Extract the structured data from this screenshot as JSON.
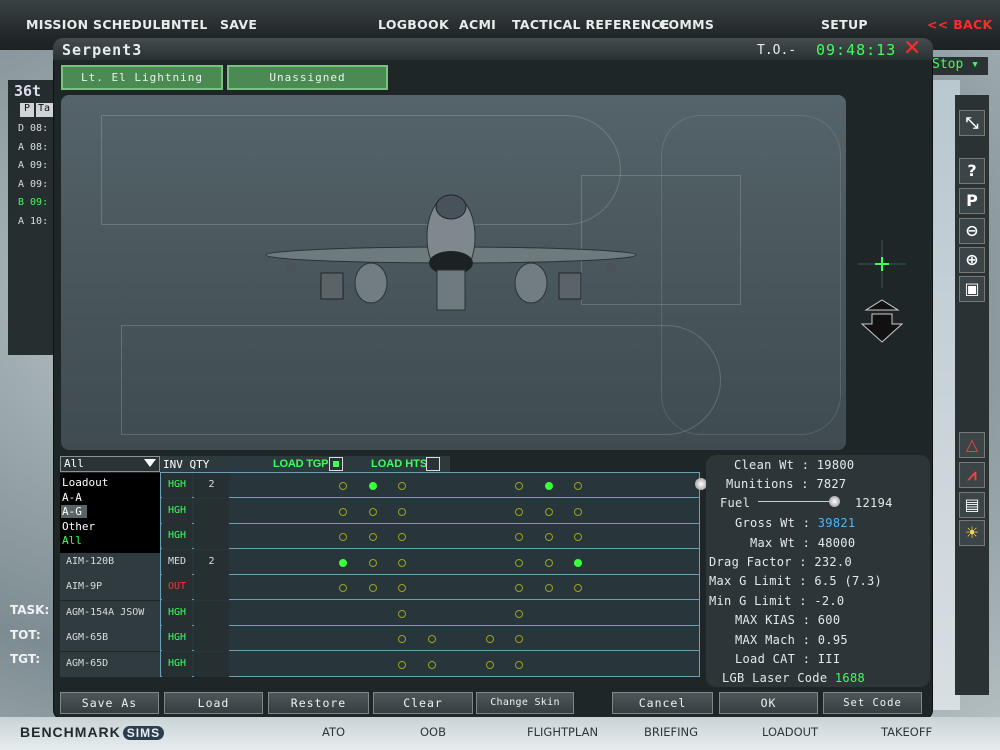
{
  "top_menu": {
    "mission_schedule": "MISSION SCHEDULE",
    "intel": "INTEL",
    "save": "SAVE",
    "logbook": "LOGBOOK",
    "acmi": "ACMI",
    "tactical_reference": "TACTICAL REFERENCE",
    "comms": "COMMS",
    "setup": "SETUP",
    "back": "<< BACK"
  },
  "background_left": {
    "title": "36t",
    "headers": [
      "P",
      "Ta"
    ],
    "rows": [
      {
        "p": "D",
        "t": "08:",
        "color": "#dddddd"
      },
      {
        "p": "A",
        "t": "08:",
        "color": "#dddddd"
      },
      {
        "p": "A",
        "t": "09:",
        "color": "#dddddd"
      },
      {
        "p": "A",
        "t": "09:",
        "color": "#dddddd"
      },
      {
        "p": "B",
        "t": "09:",
        "color": "#3cff5a"
      },
      {
        "p": "A",
        "t": "10:",
        "color": "#dddddd"
      }
    ],
    "task_label": "TASK:",
    "tot_label": "TOT:",
    "tgt_label": "TGT:"
  },
  "background_right": {
    "stop_label": "Stop ▾"
  },
  "window": {
    "title": "Serpent3",
    "to_label": "T.O.-",
    "clock": "09:48:13",
    "pilot_tabs": [
      "Lt. El Lightning",
      "Unassigned"
    ]
  },
  "loadout": {
    "filter_selected": "All",
    "filter_options": [
      {
        "label": "Loadout",
        "state": "normal"
      },
      {
        "label": "A-A",
        "state": "normal"
      },
      {
        "label": "A-G",
        "state": "selected"
      },
      {
        "label": "Other",
        "state": "normal"
      },
      {
        "label": "All",
        "state": "active"
      }
    ],
    "header_inv_qty": "INV QTY",
    "load_tgp_label": "LOAD TGP",
    "load_tgp_checked": true,
    "load_hts_label": "LOAD HTS",
    "load_hts_checked": false,
    "weapons": [
      {
        "name": "",
        "inv": "HGH",
        "qty": "2",
        "inv_color": "#3cff5a",
        "filled": [
          2,
          7
        ],
        "empty": [
          1,
          3,
          6,
          8
        ]
      },
      {
        "name": "",
        "inv": "HGH",
        "qty": "",
        "inv_color": "#3cff5a",
        "filled": [],
        "empty": [
          1,
          2,
          3,
          6,
          7,
          8
        ]
      },
      {
        "name": "",
        "inv": "HGH",
        "qty": "",
        "inv_color": "#3cff5a",
        "filled": [],
        "empty": [
          1,
          2,
          3,
          6,
          7,
          8
        ]
      },
      {
        "name": "AIM-120B",
        "inv": "MED",
        "qty": "2",
        "inv_color": "#dddddd",
        "filled": [
          1,
          8
        ],
        "empty": [
          2,
          3,
          6,
          7
        ]
      },
      {
        "name": "AIM-9P",
        "inv": "OUT",
        "qty": "",
        "inv_color": "#ff3030",
        "filled": [],
        "empty": [
          1,
          2,
          3,
          6,
          7,
          8
        ]
      },
      {
        "name": "AGM-154A JSOW",
        "inv": "HGH",
        "qty": "",
        "inv_color": "#3cff5a",
        "filled": [],
        "empty": [
          3,
          6
        ]
      },
      {
        "name": "AGM-65B",
        "inv": "HGH",
        "qty": "",
        "inv_color": "#3cff5a",
        "filled": [],
        "empty": [
          3,
          4,
          5,
          6
        ]
      },
      {
        "name": "AGM-65D",
        "inv": "HGH",
        "qty": "",
        "inv_color": "#3cff5a",
        "filled": [],
        "empty": [
          3,
          4,
          5,
          6
        ]
      }
    ]
  },
  "stats": {
    "clean_wt": {
      "label": "Clean Wt",
      "value": "19800"
    },
    "munitions": {
      "label": "Munitions",
      "value": "7827"
    },
    "fuel": {
      "label": "Fuel",
      "value": "12194"
    },
    "gross_wt": {
      "label": "Gross Wt",
      "value": "39821"
    },
    "max_wt": {
      "label": "Max Wt",
      "value": "48000"
    },
    "drag_factor": {
      "label": "Drag Factor",
      "value": "232.0"
    },
    "max_g": {
      "label": "Max G Limit",
      "value": "6.5 (7.3)"
    },
    "min_g": {
      "label": "Min G Limit",
      "value": "-2.0"
    },
    "max_kias": {
      "label": "MAX KIAS",
      "value": "600"
    },
    "max_mach": {
      "label": "MAX Mach",
      "value": "0.95"
    },
    "load_cat": {
      "label": "Load CAT",
      "value": "III"
    },
    "laser_code": {
      "label": "LGB Laser Code",
      "value": "1688"
    },
    "fuel_level": 0.95
  },
  "buttons": {
    "save_as": "Save As",
    "load": "Load",
    "restore": "Restore",
    "clear": "Clear",
    "change_skin": "Change Skin",
    "cancel": "Cancel",
    "ok": "OK",
    "set_code": "Set Code"
  },
  "bottom_bar": {
    "logo": "BENCHMARK",
    "logo_sims": "SIMS",
    "tabs": [
      "ATO",
      "OOB",
      "FLIGHTPLAN",
      "BRIEFING",
      "LOADOUT",
      "TAKEOFF"
    ]
  },
  "colors": {
    "accent_green": "#3cff5a",
    "alert_red": "#ff2a2a",
    "highlight_blue": "#4ab6ff"
  }
}
